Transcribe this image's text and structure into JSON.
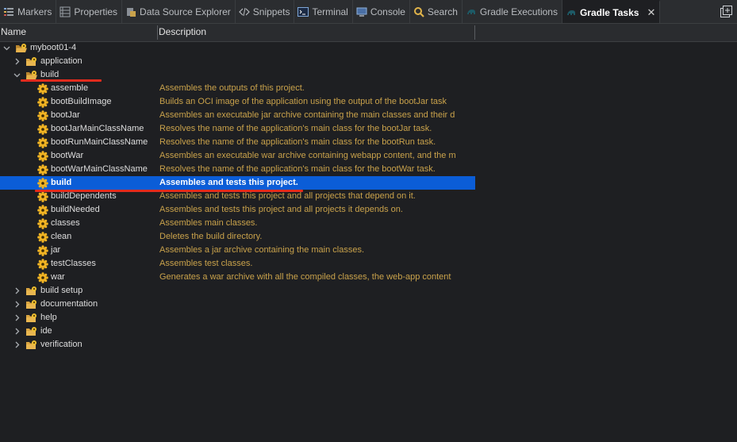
{
  "tabs": [
    {
      "label": "Markers",
      "icon": "markers-icon"
    },
    {
      "label": "Properties",
      "icon": "properties-icon"
    },
    {
      "label": "Data Source Explorer",
      "icon": "data-source-icon"
    },
    {
      "label": "Snippets",
      "icon": "snippets-icon"
    },
    {
      "label": "Terminal",
      "icon": "terminal-icon"
    },
    {
      "label": "Console",
      "icon": "console-icon"
    },
    {
      "label": "Search",
      "icon": "search-icon"
    },
    {
      "label": "Gradle Executions",
      "icon": "gradle-icon"
    },
    {
      "label": "Gradle Tasks",
      "icon": "gradle-icon",
      "active": true
    }
  ],
  "columns": {
    "name": "Name",
    "description": "Description"
  },
  "tree": {
    "project": "myboot01-4",
    "groups_before": [
      "application"
    ],
    "open_group": "build",
    "tasks": [
      {
        "name": "assemble",
        "desc": "Assembles the outputs of this project."
      },
      {
        "name": "bootBuildImage",
        "desc": "Builds an OCI image of the application using the output of the bootJar task"
      },
      {
        "name": "bootJar",
        "desc": "Assembles an executable jar archive containing the main classes and their d"
      },
      {
        "name": "bootJarMainClassName",
        "desc": "Resolves the name of the application's main class for the bootJar task."
      },
      {
        "name": "bootRunMainClassName",
        "desc": "Resolves the name of the application's main class for the bootRun task."
      },
      {
        "name": "bootWar",
        "desc": "Assembles an executable war archive containing webapp content, and the m"
      },
      {
        "name": "bootWarMainClassName",
        "desc": "Resolves the name of the application's main class for the bootWar task."
      },
      {
        "name": "build",
        "desc": "Assembles and tests this project.",
        "selected": true
      },
      {
        "name": "buildDependents",
        "desc": "Assembles and tests this project and all projects that depend on it."
      },
      {
        "name": "buildNeeded",
        "desc": "Assembles and tests this project and all projects it depends on."
      },
      {
        "name": "classes",
        "desc": "Assembles main classes."
      },
      {
        "name": "clean",
        "desc": "Deletes the build directory."
      },
      {
        "name": "jar",
        "desc": "Assembles a jar archive containing the main classes."
      },
      {
        "name": "testClasses",
        "desc": "Assembles test classes."
      },
      {
        "name": "war",
        "desc": "Generates a war archive with all the compiled classes, the web-app content"
      }
    ],
    "groups_after": [
      "build setup",
      "documentation",
      "help",
      "ide",
      "verification"
    ]
  },
  "colors": {
    "selection": "#0b5dd7",
    "description_text": "#c9a24b",
    "annotation": "#e12b1e"
  }
}
